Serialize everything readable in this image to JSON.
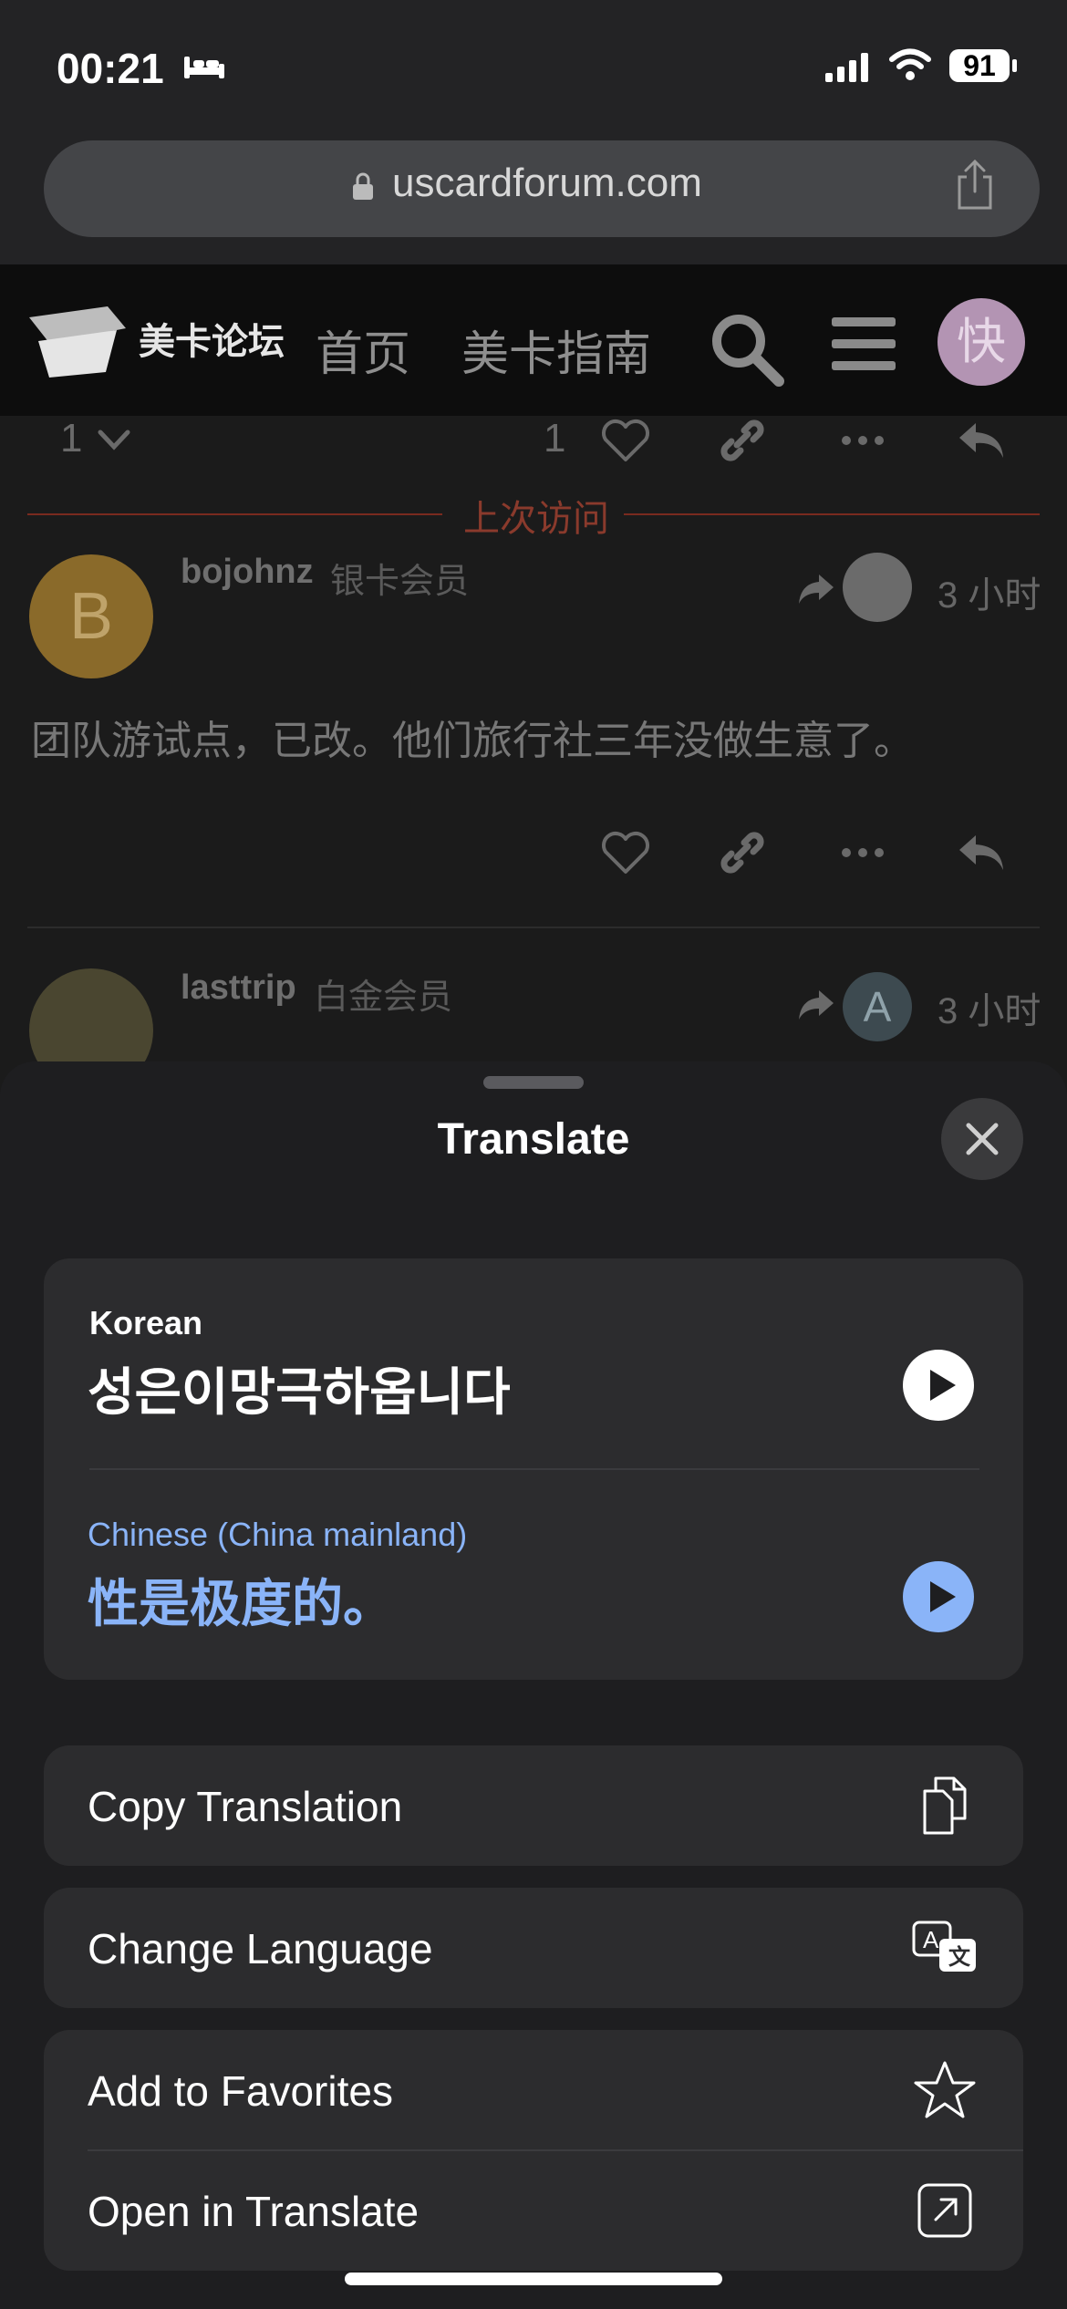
{
  "status_bar": {
    "time": "00:21",
    "battery": "91"
  },
  "browser": {
    "url": "uscardforum.com"
  },
  "site_header": {
    "logo_text": "美卡论坛",
    "nav_home": "首页",
    "nav_guide": "美卡指南",
    "avatar_initial": "快"
  },
  "post_controls": {
    "reply_count": "1",
    "like_count": "1"
  },
  "divider_label": "上次访问",
  "posts": [
    {
      "avatar_letter": "B",
      "username": "bojohnz",
      "role": "银卡会员",
      "time": "3 小时",
      "text": "团队游试点，已改。他们旅行社三年没做生意了。"
    },
    {
      "username": "lasttrip",
      "role": "白金会员",
      "reply_avatar_letter": "A",
      "time": "3 小时"
    }
  ],
  "translate_sheet": {
    "title": "Translate",
    "source_language": "Korean",
    "source_text": "성은이망극하옵니다",
    "target_language": "Chinese (China mainland)",
    "target_text": "性是极度的。",
    "actions": {
      "copy": "Copy Translation",
      "change_language": "Change Language",
      "favorites": "Add to Favorites",
      "open": "Open in Translate"
    }
  },
  "colors": {
    "accent_blue": "#8ab4f8",
    "divider_red": "#7a2a1f",
    "sheet_bg": "#1e1e20",
    "card_bg": "#2c2c2e"
  }
}
